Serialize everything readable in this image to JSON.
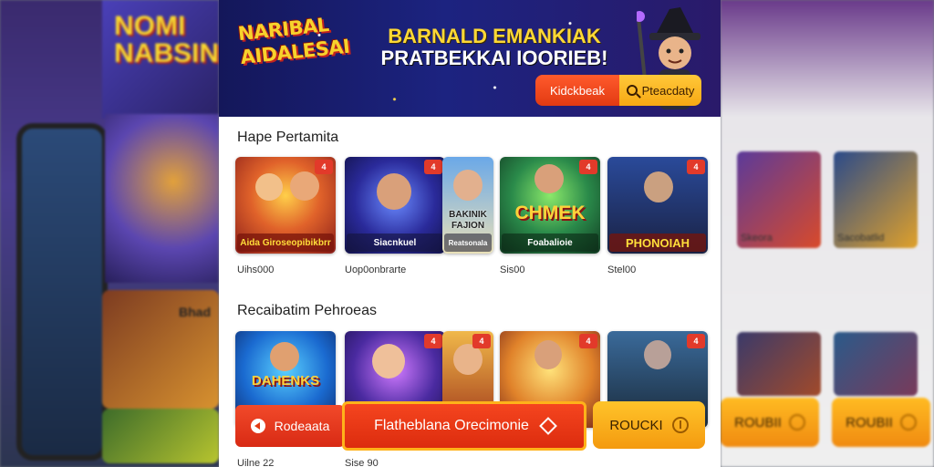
{
  "banner": {
    "logo_lines": [
      "NARIBAL",
      "AIDALESAI"
    ],
    "headline_line1": "BARNALD EMANKIAK",
    "headline_line2": "PRATBEKKAI IOORIEB!",
    "kickback_button": "Kidckbeak",
    "deposit_button": "Pteacdaty"
  },
  "sections": [
    {
      "title": "Hape Pertamita",
      "cards": [
        {
          "caption": "Aida Giroseopibikbrr",
          "badge": "4",
          "price": "Uihs000"
        },
        {
          "caption": "Siacnkuel",
          "badge": "4",
          "price": "Uop0onbrarte"
        },
        {
          "caption": "Reatsonala",
          "top_text": "BAKINIK FAJION",
          "badge": "",
          "price": ""
        },
        {
          "caption": "Foabalioie",
          "top_text": "CHMEK",
          "badge": "4",
          "price": "Sis00"
        },
        {
          "caption": "PHONOIAH",
          "badge": "4",
          "price": "Stel00"
        }
      ]
    },
    {
      "title": "Recaibatim Pehroeas",
      "cards": [
        {
          "caption": "DAHENKS",
          "badge": "",
          "price": "Uilne 22"
        },
        {
          "caption": "",
          "badge": "4",
          "price": "Sise 90"
        },
        {
          "caption": "",
          "badge": "4",
          "price": ""
        },
        {
          "caption": "",
          "badge": "4",
          "price": ""
        },
        {
          "caption": "",
          "badge": "4",
          "price": ""
        }
      ]
    }
  ],
  "actions": {
    "refresh_button": "Rodeaata",
    "primary_button": "Flatheblana Orecimonie",
    "gold_button": "ROUCKI"
  },
  "side_left": {
    "promo_text": "NOMI NABSIN",
    "card_text": "Bhad"
  },
  "side_right": {
    "card_captions": [
      "Skeora",
      "Sacobatlid"
    ],
    "button_label": "ROUBII",
    "button_label_2": "ROUBII"
  },
  "colors": {
    "banner_bg": "#1c2380",
    "accent_red": "#e23a12",
    "accent_gold": "#f7a813",
    "logo_yellow": "#f7d22c"
  }
}
